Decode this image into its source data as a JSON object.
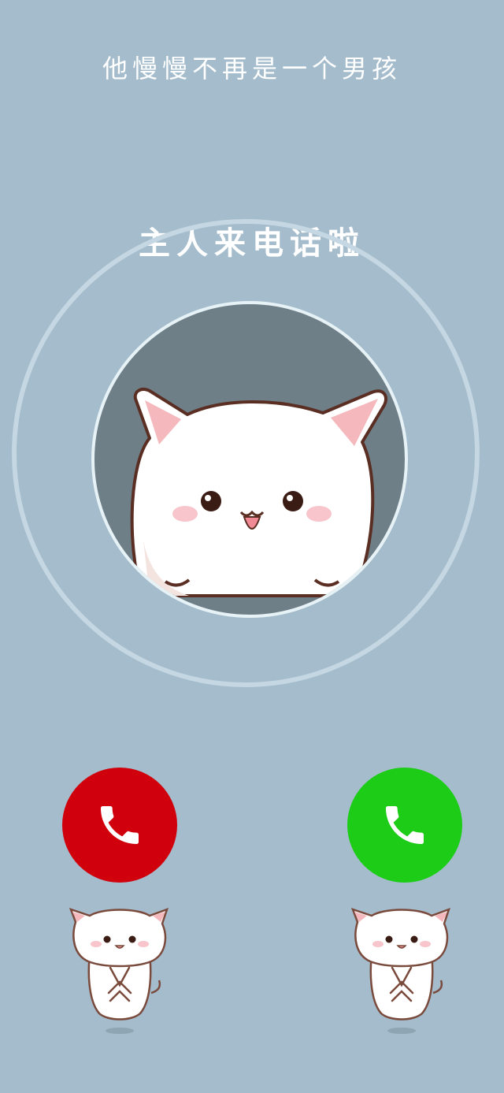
{
  "caption": "他慢慢不再是一个男孩",
  "call": {
    "title": "主人来电话啦"
  },
  "buttons": {
    "decline_icon": "phone-icon",
    "accept_icon": "phone-icon",
    "decline_color": "#d0000c",
    "accept_color": "#1ccc17"
  },
  "colors": {
    "background": "#a4bccb",
    "avatar_bg": "#6e7f87"
  }
}
